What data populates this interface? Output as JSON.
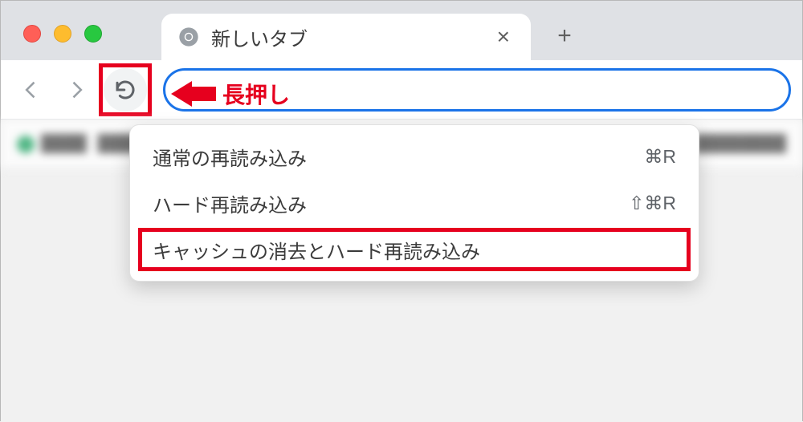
{
  "tab": {
    "title": "新しいタブ"
  },
  "annotation": {
    "label": "長押し"
  },
  "context_menu": {
    "items": [
      {
        "label": "通常の再読み込み",
        "shortcut": "⌘R",
        "highlighted": false
      },
      {
        "label": "ハード再読み込み",
        "shortcut": "⇧⌘R",
        "highlighted": false
      },
      {
        "label": "キャッシュの消去とハード再読み込み",
        "shortcut": "",
        "highlighted": true
      }
    ]
  },
  "colors": {
    "highlight": "#e6001e",
    "omnibox_focus": "#1a73e8"
  }
}
